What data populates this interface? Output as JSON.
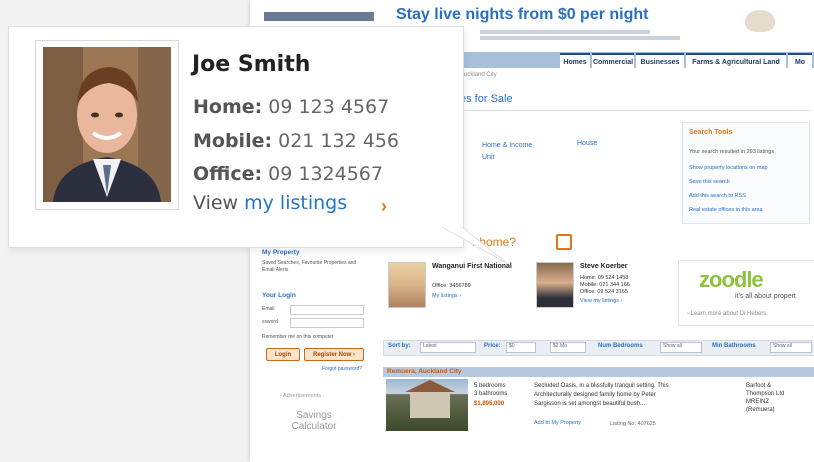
{
  "contact": {
    "name": "Joe Smith",
    "home_label": "Home:",
    "home_value": "09 123 4567",
    "mobile_label": "Mobile:",
    "mobile_value": "021 132 456",
    "office_label": "Office:",
    "office_value": "09 1324567",
    "view_prefix": "View",
    "view_link": "my listings",
    "chevron": "›"
  },
  "background": {
    "banner_slogan": "Stay live nights from $0 per night",
    "tabs": [
      "Homes",
      "Commercial",
      "Businesses",
      "Farms & Agricultural Land",
      "Mo"
    ],
    "breadcrumb": "Auckland City",
    "page_title": "es for Sale",
    "property_types": [
      "Home & Income",
      "Unit"
    ],
    "property_house": "House",
    "search_tools": {
      "title": "Search Tools",
      "lines": [
        "Your search resulted in 293 listings",
        "Show property locations on map",
        "Save this search",
        "Add this search to RSS",
        "Real estate offices in this area"
      ]
    },
    "agent_heading": "r home?",
    "agents": [
      {
        "name": "Wanganui First National",
        "office": "Office: 3456789",
        "link": "My listings ›"
      },
      {
        "name": "Steve Koerber",
        "home": "Home: 09 524 1458",
        "mobile": "Mobile: 021 344 166",
        "office": "Office: 09 524 3165",
        "link": "View my listings ›"
      }
    ],
    "zoodle": {
      "brand": "zoodle",
      "tagline": "it's all about propert",
      "more": "› Learn more about Di Hebers"
    },
    "sidebar": {
      "my_property": "My Property",
      "my_property_text": "Saved Searches, Favourite Properties and Email Alerts",
      "login_title": "Your Login",
      "email_label": "Email",
      "password_label": "ssword",
      "remember": "Remember me on this computer",
      "login_button": "Login",
      "register_button": "Register Now ›",
      "forgot": "Forgot password?",
      "ads": "- Advertisements -",
      "savings": "Savings Calculator"
    },
    "sortbar": {
      "sort_by": "Sort by:",
      "sort_value": "Latest",
      "price": "Price:",
      "price_from": "$0",
      "price_to": "$2 Mo",
      "bedrooms": "Num Bedrooms",
      "bedrooms_value": "Show all",
      "bathrooms": "Min Bathrooms",
      "bathrooms_value": "Show all"
    },
    "listing": {
      "location": "Remuera, Auckland City",
      "bedrooms": "5 bedrooms",
      "bathrooms": "3 bathrooms",
      "price": "$1,895,000",
      "desc1": "Secluded Oasis, in a blissfully tranquil setting. This",
      "desc2": "Architecturally designed family home by Peter",
      "desc3": "Sargisson is set amongst beautiful bush...",
      "add_link": "Add to My Property",
      "listing_no": "Listing No: 407625",
      "agent1": "Barfoot &",
      "agent2": "Thompson Ltd",
      "agent3": "MREINZ",
      "agent4": "(Remuera)"
    }
  }
}
